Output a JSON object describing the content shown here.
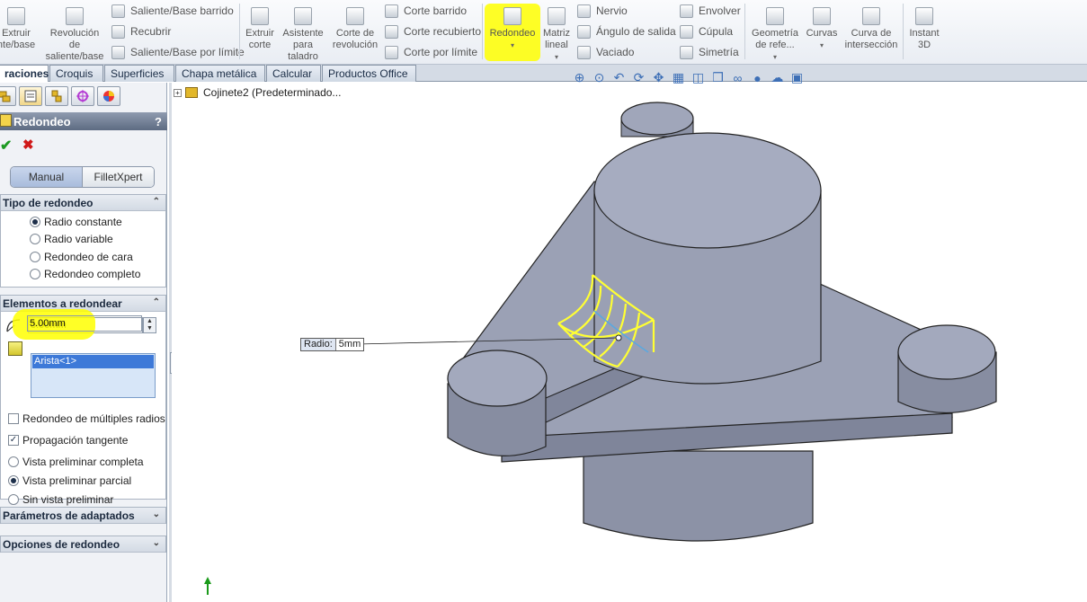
{
  "ribbon": {
    "extrude_label": "Extruir\nnte/base",
    "revolve_label": "Revolución\nde\nsaliente/base",
    "sweep_boss": "Saliente/Base barrido",
    "loft_boss": "Recubrir",
    "boundary_boss": "Saliente/Base por límite",
    "extrude_cut": "Extruir\ncorte",
    "hole_wizard": "Asistente\npara\ntaladro",
    "revolve_cut": "Corte de\nrevolución",
    "sweep_cut": "Corte barrido",
    "loft_cut": "Corte recubierto",
    "boundary_cut": "Corte por límite",
    "fillet": "Redondeo",
    "linear_pattern": "Matriz\nlineal",
    "rib": "Nervio",
    "draft": "Ángulo de salida",
    "shell": "Vaciado",
    "wrap": "Envolver",
    "dome": "Cúpula",
    "mirror": "Simetría",
    "ref_geometry": "Geometría\nde refe...",
    "curves": "Curvas",
    "intersection_curve": "Curva de\nintersección",
    "instant3d": "Instant\n3D"
  },
  "tabs": [
    {
      "label": "raciones",
      "active": true
    },
    {
      "label": "Croquis"
    },
    {
      "label": "Superficies"
    },
    {
      "label": "Chapa metálica"
    },
    {
      "label": "Calcular"
    },
    {
      "label": "Productos Office"
    }
  ],
  "panel": {
    "title": "Redondeo",
    "help": "?",
    "ok": "✔",
    "cancel": "✖",
    "mode_manual": "Manual",
    "mode_filletxpert": "FilletXpert",
    "fillet_type": {
      "header": "Tipo de redondeo",
      "options": [
        "Radio constante",
        "Radio variable",
        "Redondeo de cara",
        "Redondeo completo"
      ],
      "selected": "Radio constante"
    },
    "items": {
      "header": "Elementos a redondear",
      "radius_value": "5.00mm",
      "edge": "Arista<1>",
      "multi_radius": "Redondeo de múltiples radios",
      "tangent": "Propagación tangente",
      "preview_full": "Vista preliminar completa",
      "preview_partial": "Vista preliminar parcial",
      "no_preview": "Sin vista preliminar"
    },
    "setback_header": "Parámetros de adaptados",
    "options_header": "Opciones de redondeo"
  },
  "viewport": {
    "tree_item": "Cojinete2  (Predeterminado...",
    "callout_key": "Radio:",
    "callout_value": "5mm"
  },
  "colors": {
    "highlight": "#ffff00",
    "model_fill": "#9ca2b6",
    "fillet_preview": "#ffff33"
  }
}
